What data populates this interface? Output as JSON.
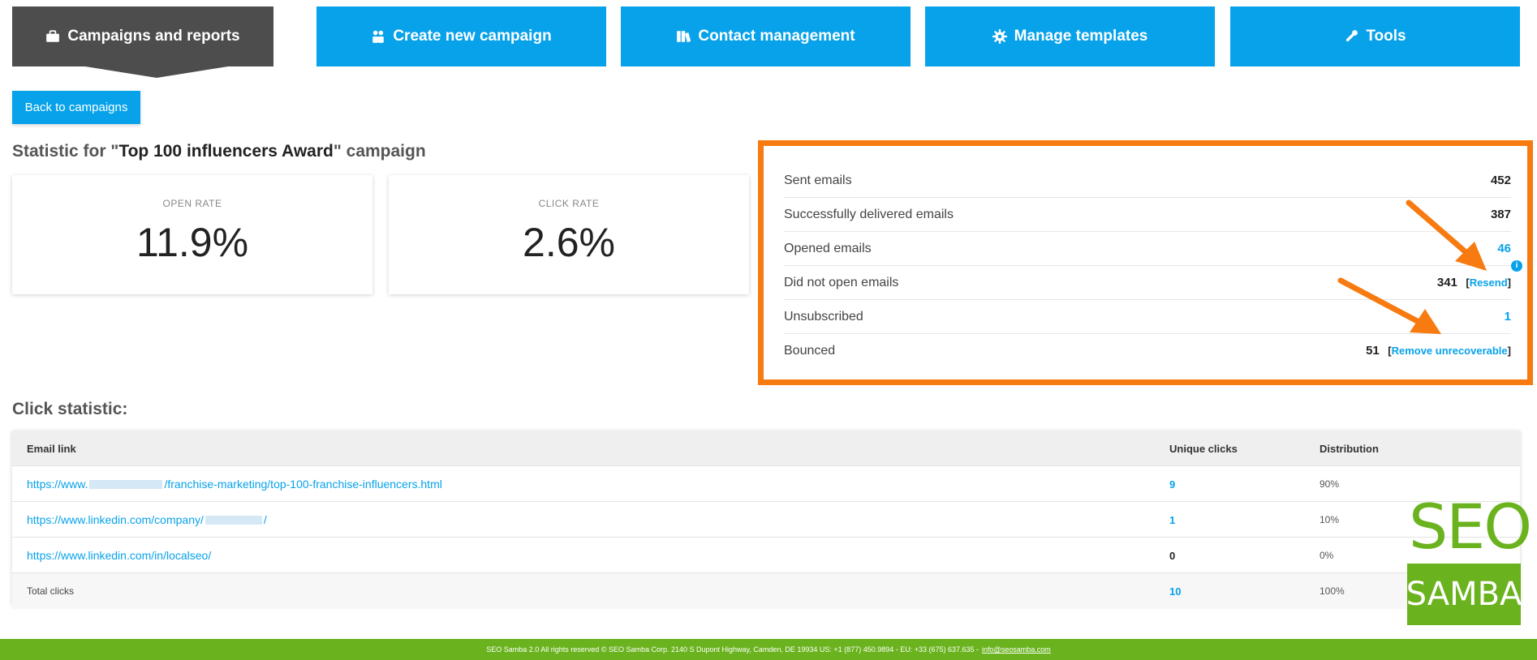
{
  "nav": {
    "tabs": [
      {
        "label": "Campaigns and reports",
        "icon": "briefcase-icon",
        "active": true
      },
      {
        "label": "Create new campaign",
        "icon": "users-icon",
        "active": false
      },
      {
        "label": "Contact management",
        "icon": "address-book-icon",
        "active": false
      },
      {
        "label": "Manage templates",
        "icon": "gear-icon",
        "active": false
      },
      {
        "label": "Tools",
        "icon": "wrench-icon",
        "active": false
      }
    ]
  },
  "back_button": "Back to campaigns",
  "statistic": {
    "prefix": "Statistic for \"",
    "campaign_name": "Top 100 influencers Award",
    "suffix": "\" campaign"
  },
  "rates": {
    "open": {
      "label": "OPEN RATE",
      "value": "11.9%"
    },
    "click": {
      "label": "CLICK RATE",
      "value": "2.6%"
    }
  },
  "email_stats": [
    {
      "label": "Sent emails",
      "value": "452"
    },
    {
      "label": "Successfully delivered emails",
      "value": "387"
    },
    {
      "label": "Opened emails",
      "value": "46"
    },
    {
      "label": "Did not open emails",
      "value": "341",
      "action": "Resend"
    },
    {
      "label": "Unsubscribed",
      "value": "1"
    },
    {
      "label": "Bounced",
      "value": "51",
      "action": "Remove unrecoverable"
    }
  ],
  "click_statistic": {
    "title": "Click statistic:",
    "headers": {
      "link": "Email link",
      "unique": "Unique clicks",
      "distribution": "Distribution"
    },
    "rows": [
      {
        "link_start": "https://www.",
        "link_end": "/franchise-marketing/top-100-franchise-influencers.html",
        "unique": "9",
        "distribution": "90%"
      },
      {
        "link_start": "https://www.linkedin.com/company/",
        "link_end": "/",
        "unique": "1",
        "distribution": "10%"
      },
      {
        "link": "https://www.linkedin.com/in/localseo/",
        "unique": "0",
        "distribution": "0%"
      }
    ],
    "total": {
      "label": "Total clicks",
      "unique": "10",
      "distribution": "100%"
    }
  },
  "logo": {
    "top": "SEO",
    "bottom": "SAMBA"
  },
  "footer": {
    "text": "SEO Samba 2.0  All rights reserved © SEO Samba Corp. 2140 S Dupont Highway, Camden, DE 19934 US: +1 (877) 450.9894 - EU: +33 (675) 637.635 -",
    "email": "info@seosamba.com"
  },
  "colors": {
    "accent": "#07a2ea",
    "active_tab": "#4d4d4d",
    "highlight": "#f77b10",
    "brand_green": "#6ab31e"
  }
}
